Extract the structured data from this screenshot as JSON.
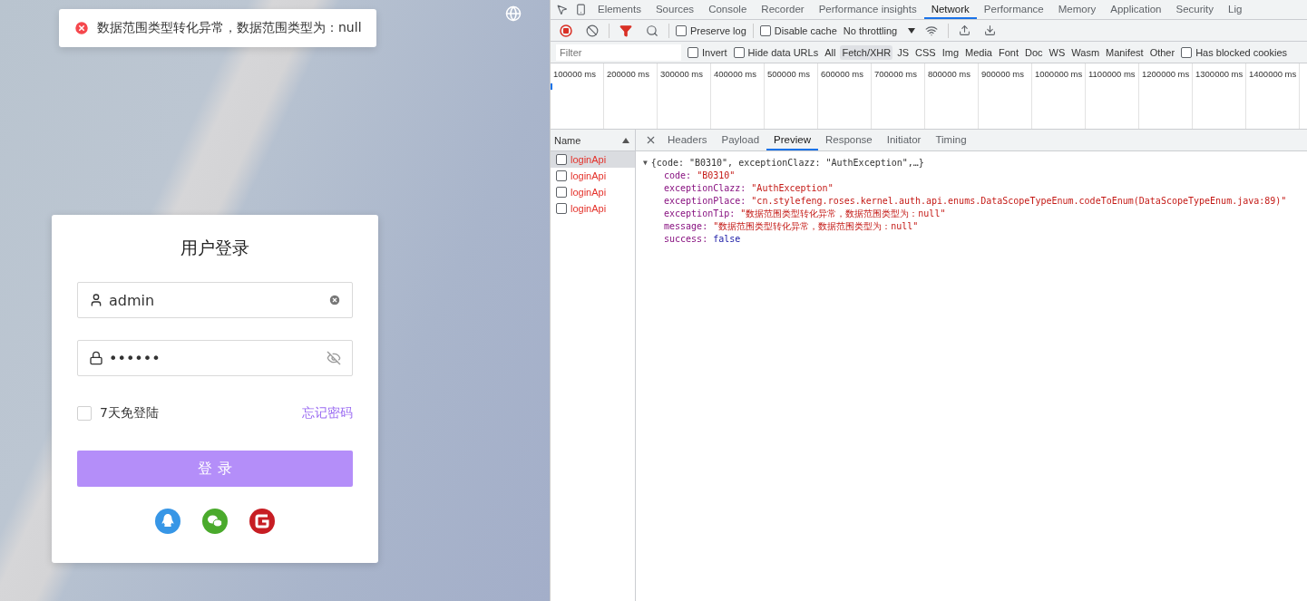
{
  "page": {
    "toast": {
      "kind": "error",
      "message": "数据范围类型转化异常，数据范围类型为：null"
    },
    "login": {
      "title": "用户登录",
      "username": {
        "value": "admin"
      },
      "password": {
        "value": "••••••"
      },
      "remember": {
        "label": "7天免登陆",
        "checked": false
      },
      "forgot_link": "忘记密码",
      "submit": "登 录",
      "social": [
        {
          "kind": "qq"
        },
        {
          "kind": "wechat"
        },
        {
          "kind": "gitee"
        }
      ]
    }
  },
  "devtools": {
    "tabs": [
      {
        "label": "Elements",
        "selected": false
      },
      {
        "label": "Sources",
        "selected": false
      },
      {
        "label": "Console",
        "selected": false
      },
      {
        "label": "Recorder",
        "selected": false
      },
      {
        "label": "Performance insights",
        "selected": false
      },
      {
        "label": "Network",
        "selected": true
      },
      {
        "label": "Performance",
        "selected": false
      },
      {
        "label": "Memory",
        "selected": false
      },
      {
        "label": "Application",
        "selected": false
      },
      {
        "label": "Security",
        "selected": false
      },
      {
        "label": "Lig",
        "selected": false
      }
    ],
    "toolbar": {
      "recording": true,
      "preserve_log": {
        "label": "Preserve log",
        "checked": false
      },
      "disable_cache": {
        "label": "Disable cache",
        "checked": false
      },
      "throttling": "No throttling"
    },
    "filter": {
      "placeholder": "Filter",
      "invert": {
        "label": "Invert",
        "checked": false
      },
      "hide_data_urls": {
        "label": "Hide data URLs",
        "checked": false
      },
      "types": [
        {
          "label": "All",
          "selected": false
        },
        {
          "label": "Fetch/XHR",
          "selected": true
        },
        {
          "label": "JS",
          "selected": false
        },
        {
          "label": "CSS",
          "selected": false
        },
        {
          "label": "Img",
          "selected": false
        },
        {
          "label": "Media",
          "selected": false
        },
        {
          "label": "Font",
          "selected": false
        },
        {
          "label": "Doc",
          "selected": false
        },
        {
          "label": "WS",
          "selected": false
        },
        {
          "label": "Wasm",
          "selected": false
        },
        {
          "label": "Manifest",
          "selected": false
        },
        {
          "label": "Other",
          "selected": false
        }
      ],
      "blocked_cookies": {
        "label": "Has blocked cookies",
        "checked": false
      }
    },
    "timeline": [
      "100000 ms",
      "200000 ms",
      "300000 ms",
      "400000 ms",
      "500000 ms",
      "600000 ms",
      "700000 ms",
      "800000 ms",
      "900000 ms",
      "1000000 ms",
      "1100000 ms",
      "1200000 ms",
      "1300000 ms",
      "1400000 ms"
    ],
    "requests": {
      "header": "Name",
      "rows": [
        {
          "name": "loginApi",
          "selected": true
        },
        {
          "name": "loginApi",
          "selected": false
        },
        {
          "name": "loginApi",
          "selected": false
        },
        {
          "name": "loginApi",
          "selected": false
        }
      ]
    },
    "detail_tabs": [
      {
        "label": "Headers",
        "selected": false
      },
      {
        "label": "Payload",
        "selected": false
      },
      {
        "label": "Preview",
        "selected": true
      },
      {
        "label": "Response",
        "selected": false
      },
      {
        "label": "Initiator",
        "selected": false
      },
      {
        "label": "Timing",
        "selected": false
      }
    ],
    "preview": {
      "toggle": "▼",
      "summary": "{code: \"B0310\", exceptionClazz: \"AuthException\",…}",
      "expanded": true,
      "properties": [
        {
          "key": "code:",
          "value": "\"B0310\"",
          "kind": "string"
        },
        {
          "key": "exceptionClazz:",
          "value": "\"AuthException\"",
          "kind": "string"
        },
        {
          "key": "exceptionPlace:",
          "value": "\"cn.stylefeng.roses.kernel.auth.api.enums.DataScopeTypeEnum.codeToEnum(DataScopeTypeEnum.java:89)\"",
          "kind": "string"
        },
        {
          "key": "exceptionTip:",
          "value": "\"数据范围类型转化异常，数据范围类型为：null\"",
          "kind": "string"
        },
        {
          "key": "message:",
          "value": "\"数据范围类型转化异常，数据范围类型为：null\"",
          "kind": "string"
        },
        {
          "key": "success:",
          "value": "false",
          "kind": "boolean"
        }
      ]
    }
  }
}
